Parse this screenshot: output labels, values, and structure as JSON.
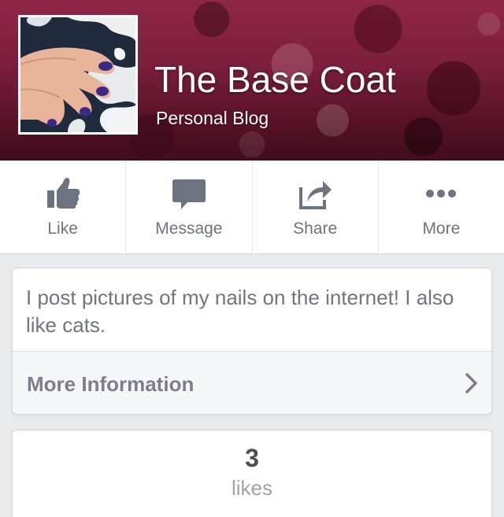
{
  "header": {
    "page_name": "The Base Coat",
    "category": "Personal Blog"
  },
  "actions": [
    {
      "label": "Like",
      "icon": "thumbs-up-icon"
    },
    {
      "label": "Message",
      "icon": "speech-bubble-icon"
    },
    {
      "label": "Share",
      "icon": "share-arrow-icon"
    },
    {
      "label": "More",
      "icon": "more-dots-icon"
    }
  ],
  "about": {
    "description": "I post pictures of my nails on the internet! I also like cats.",
    "more_info_label": "More Information"
  },
  "likes": {
    "count": "3",
    "label": "likes"
  },
  "colors": {
    "cover_primary": "#7a1d3a",
    "icon_gray": "#6d7480",
    "background": "#e9eaed"
  }
}
